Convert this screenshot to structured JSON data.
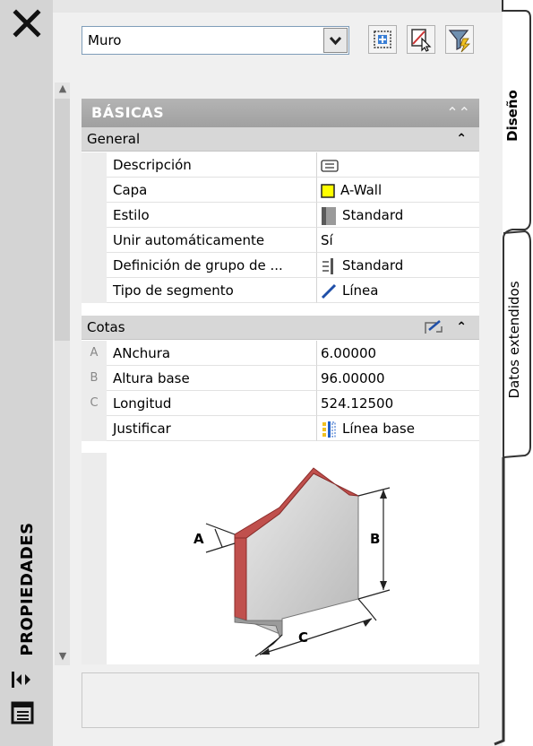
{
  "title_bar": {
    "title": "PROPIEDADES",
    "icons": [
      "close-icon",
      "auto-hide-icon",
      "properties-menu-icon"
    ]
  },
  "selector": {
    "value": "Muro",
    "toolbar_icons": [
      "quick-select-icon",
      "select-objects-icon",
      "toggle-pickadd-icon"
    ]
  },
  "groups": {
    "basicas": {
      "label": "BÁSICAS",
      "state": "expanded"
    },
    "general": {
      "label": "General"
    },
    "cotas": {
      "label": "Cotas"
    }
  },
  "general_props": [
    {
      "name": "Descripción",
      "value": "",
      "icon": "description-icon"
    },
    {
      "name": "Capa",
      "value": "A-Wall",
      "icon": "layer-color-icon"
    },
    {
      "name": "Estilo",
      "value": "Standard",
      "icon": "style-swatch-icon"
    },
    {
      "name": "Unir automáticamente",
      "value": "Sí",
      "icon": ""
    },
    {
      "name": "Definición de grupo de ...",
      "value": "Standard",
      "icon": "group-definition-icon"
    },
    {
      "name": "Tipo de segmento",
      "value": "Línea",
      "icon": "line-segment-icon"
    }
  ],
  "cotas_props": [
    {
      "key": "A",
      "name": "ANchura",
      "value": "6.00000"
    },
    {
      "key": "B",
      "name": "Altura base",
      "value": "96.00000"
    },
    {
      "key": "C",
      "name": "Longitud",
      "value": "524.12500"
    },
    {
      "key": "",
      "name": "Justificar",
      "value": "Línea base",
      "icon": "justify-icon"
    }
  ],
  "diagram_labels": {
    "a": "A",
    "b": "B",
    "c": "C"
  },
  "tabs": [
    {
      "label": "Diseño",
      "active": true
    },
    {
      "label": "Datos extendidos",
      "active": false
    }
  ],
  "colors": {
    "layer_swatch": "#ffff00",
    "wall_edge": "#c0504d"
  }
}
